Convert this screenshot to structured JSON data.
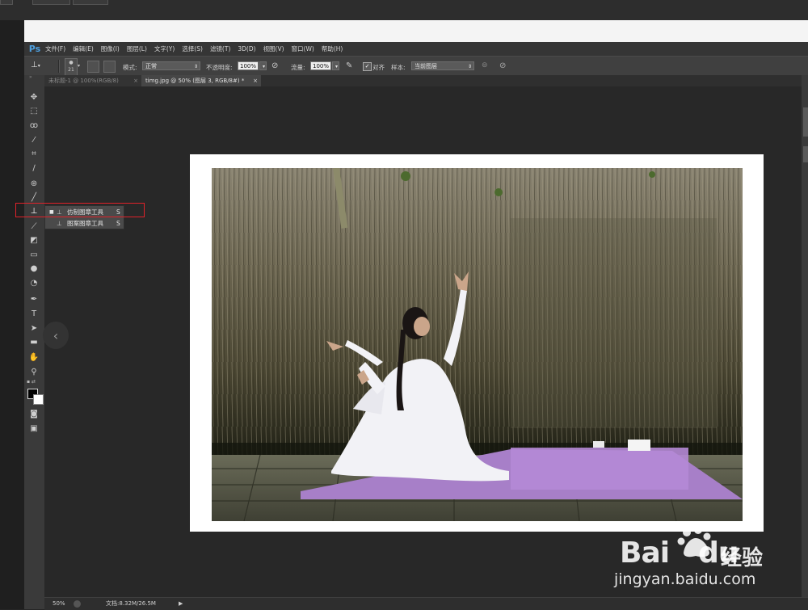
{
  "app": {
    "logo": "Ps"
  },
  "menu": [
    "文件(F)",
    "编辑(E)",
    "图像(I)",
    "图层(L)",
    "文字(Y)",
    "选择(S)",
    "滤镜(T)",
    "3D(D)",
    "视图(V)",
    "窗口(W)",
    "帮助(H)"
  ],
  "options": {
    "brush_size": "21",
    "mode_label": "模式:",
    "mode_value": "正常",
    "opacity_label": "不透明度:",
    "opacity_value": "100%",
    "flow_label": "流量:",
    "flow_value": "100%",
    "align_label": "对齐",
    "sample_label": "样本:",
    "sample_value": "当前图层"
  },
  "tabs": [
    {
      "label": "未标题-1 @ 100%(RGB/8)",
      "close": "×",
      "active": false
    },
    {
      "label": "timg.jpg @ 50% (图层 3, RGB/8#) *",
      "close": "×",
      "active": true
    }
  ],
  "flyout": {
    "items": [
      {
        "label": "仿制图章工具",
        "shortcut": "S",
        "selected": true
      },
      {
        "label": "图案图章工具",
        "shortcut": "S",
        "selected": false
      }
    ]
  },
  "status": {
    "zoom": "50%",
    "doc": "文档:8.32M/26.5M"
  },
  "watermark": {
    "brand": "Bai",
    "brand_suffix": "du",
    "jingyan": "经验",
    "url": "jingyan.baidu.com"
  },
  "colors": {
    "accent_blue": "#4ea0e0",
    "highlight_red": "#e0222a",
    "mat_purple": "#a77fc8"
  },
  "icons": [
    "move-icon",
    "marquee-icon",
    "lasso-icon",
    "quick-select-icon",
    "crop-icon",
    "eyedropper-icon",
    "healing-icon",
    "brush-icon",
    "clone-stamp-icon",
    "history-brush-icon",
    "eraser-icon",
    "gradient-icon",
    "blur-icon",
    "dodge-icon",
    "pen-icon",
    "type-icon",
    "path-select-icon",
    "shape-icon",
    "hand-icon",
    "zoom-icon"
  ]
}
